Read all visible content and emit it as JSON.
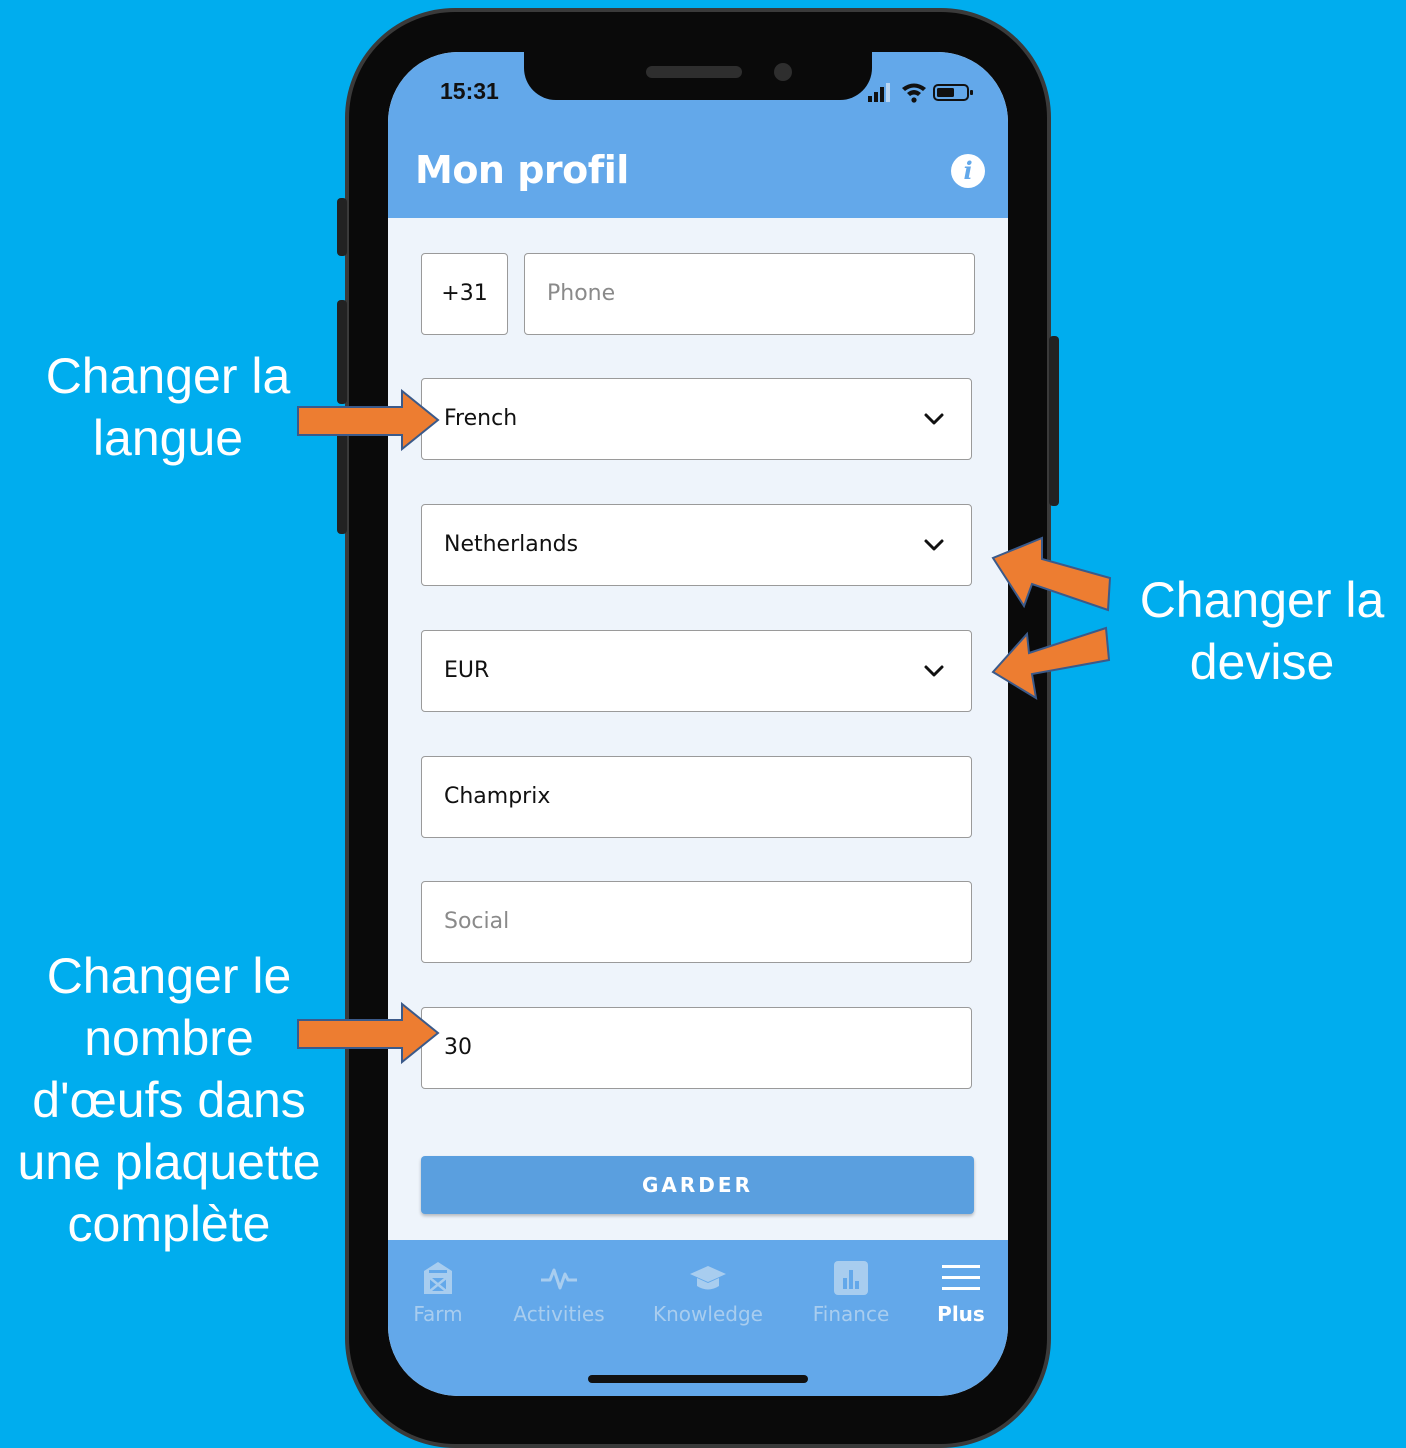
{
  "callouts": {
    "language": "Changer la\nlangue",
    "currency": "Changer la\ndevise",
    "eggs": "Changer le\nnombre\nd'œufs dans\nune plaquette\ncomplète"
  },
  "status_bar": {
    "time": "15:31"
  },
  "header": {
    "title": "Mon profil",
    "info_icon": "i"
  },
  "form": {
    "country_code": "+31",
    "phone_placeholder": "Phone",
    "language": "French",
    "country": "Netherlands",
    "currency": "EUR",
    "company": "Champrix",
    "social_placeholder": "Social",
    "eggs_per_tray": "30",
    "save_label": "GARDER"
  },
  "tabs": [
    {
      "label": "Farm",
      "icon": "barn-icon"
    },
    {
      "label": "Activities",
      "icon": "pulse-icon"
    },
    {
      "label": "Knowledge",
      "icon": "graduation-cap-icon"
    },
    {
      "label": "Finance",
      "icon": "bar-chart-icon"
    },
    {
      "label": "Plus",
      "icon": "menu-icon",
      "active": true
    }
  ],
  "colors": {
    "background": "#00ADEE",
    "header": "#63A8EA",
    "arrow": "#ED7D31",
    "save_button": "#5A9FDF"
  }
}
